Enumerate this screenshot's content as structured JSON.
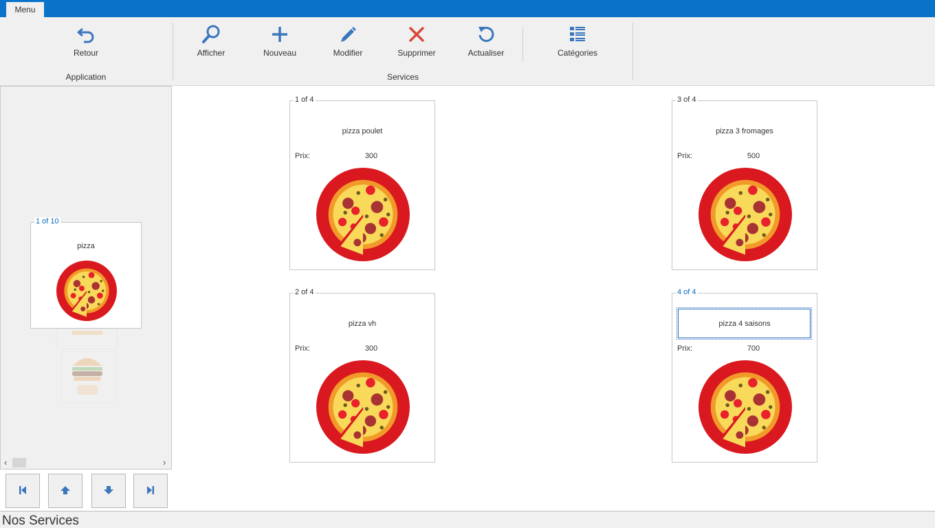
{
  "menu": {
    "tab_label": "Menu"
  },
  "ribbon": {
    "groups": [
      {
        "label": "Application"
      },
      {
        "label": "Services"
      }
    ],
    "buttons": {
      "retour": "Retour",
      "afficher": "Afficher",
      "nouveau": "Nouveau",
      "modifier": "Modifier",
      "supprimer": "Supprimer",
      "actualiser": "Actualiser",
      "categories": "Catégories"
    }
  },
  "categories_panel": {
    "card": {
      "legend": "1 of 10",
      "title": "pizza"
    }
  },
  "services": {
    "price_label": "Prix:",
    "cards": [
      {
        "legend": "1 of 4",
        "title": "pizza poulet",
        "price": "300"
      },
      {
        "legend": "3 of 4",
        "title": "pizza 3 fromages",
        "price": "500"
      },
      {
        "legend": "2 of 4",
        "title": "pizza vh",
        "price": "300"
      },
      {
        "legend": "4 of 4",
        "title": "pizza 4 saisons",
        "price": "700"
      }
    ]
  },
  "status": {
    "text": "Nos Services"
  },
  "icons": {
    "retour": "undo-icon",
    "afficher": "magnifier-icon",
    "nouveau": "plus-icon",
    "modifier": "pencil-icon",
    "supprimer": "cross-icon",
    "actualiser": "refresh-icon",
    "categories": "list-icon",
    "nav_first": "first-icon",
    "nav_prev": "arrow-up-icon",
    "nav_next": "arrow-down-icon",
    "nav_last": "last-icon"
  },
  "colors": {
    "title_bar": "#0a73c9",
    "icon_blue": "#3a77bd",
    "delete_red": "#d9473b",
    "pizza_rim": "#d9191f",
    "pizza_crust": "#f19a2a",
    "pizza_cheese": "#f8d95a",
    "selected_blue": "#0a6ac4"
  }
}
